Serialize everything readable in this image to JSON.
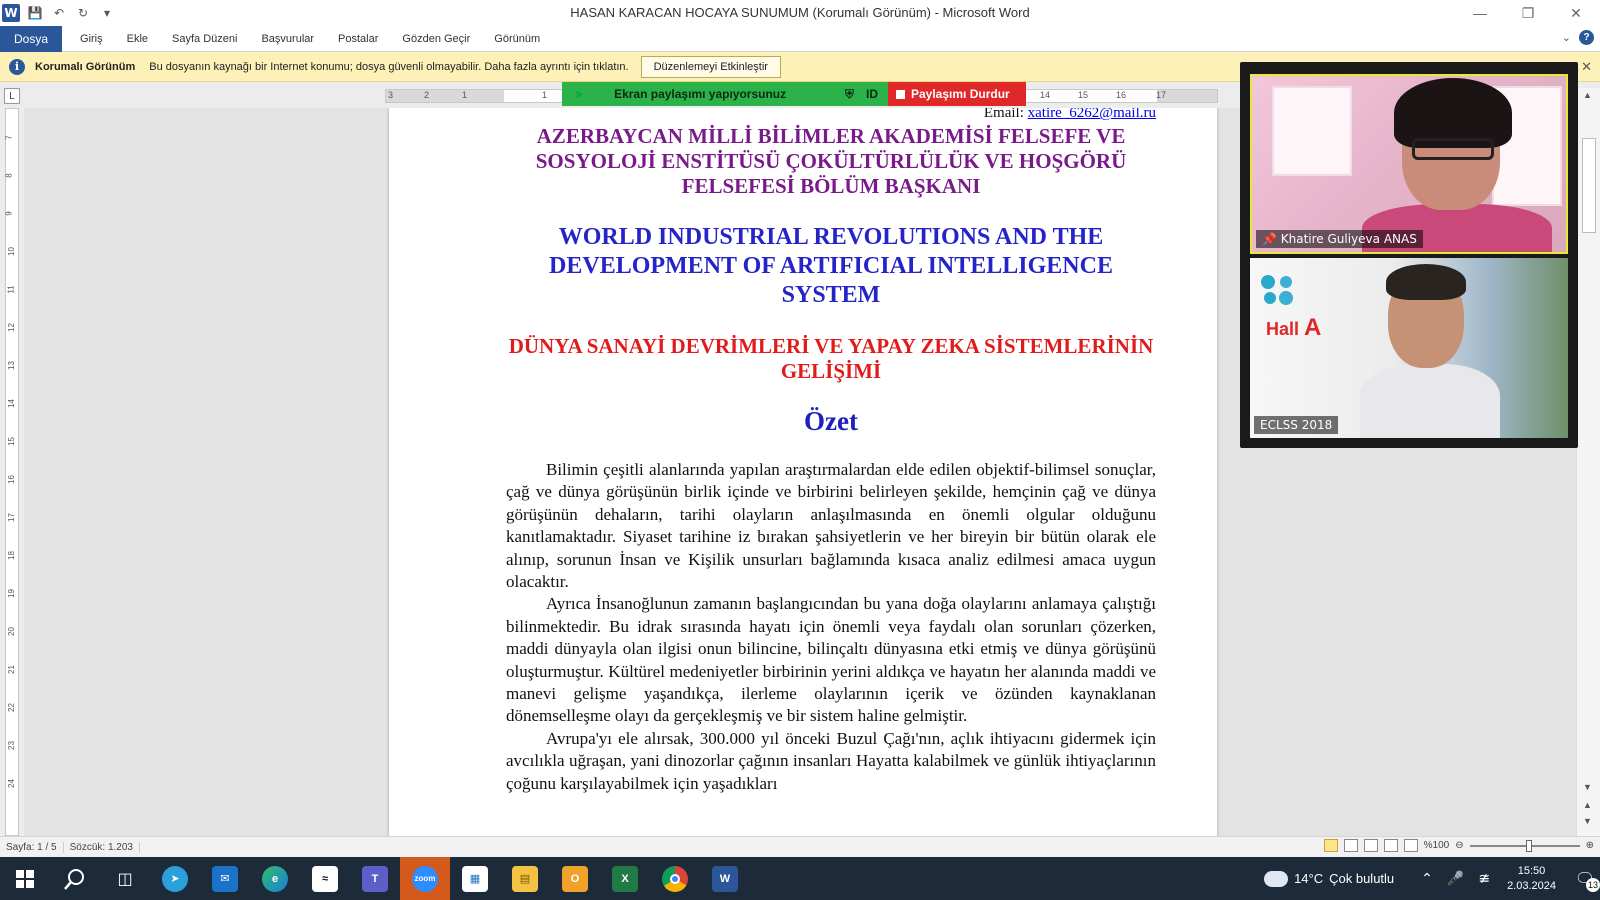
{
  "window": {
    "title": "HASAN  KARACAN HOCAYA SUNUMUM (Korumalı Görünüm) - Microsoft Word"
  },
  "ribbon": {
    "tabs": [
      "Dosya",
      "Giriş",
      "Ekle",
      "Sayfa Düzeni",
      "Başvurular",
      "Postalar",
      "Gözden Geçir",
      "Görünüm"
    ]
  },
  "protected_view": {
    "title": "Korumalı Görünüm",
    "message": "Bu dosyanın kaynağı bir Internet konumu; dosya güvenli olmayabilir. Daha fazla ayrıntı için tıklatın.",
    "button": "Düzenlemeyi Etkinleştir"
  },
  "share_banner": {
    "status": "Ekran paylaşımı yapıyorsunuz",
    "id_label": "ID",
    "stop_button": "Paylaşımı Durdur"
  },
  "ruler": {
    "h_ticks": [
      "3",
      "2",
      "1",
      "1",
      "14",
      "15",
      "16",
      "17"
    ],
    "v_ticks": [
      "7",
      "8",
      "9",
      "10",
      "11",
      "12",
      "13",
      "14",
      "15",
      "16",
      "17",
      "18",
      "19",
      "20",
      "21",
      "22",
      "23",
      "24"
    ]
  },
  "document": {
    "email_label": "Email: ",
    "email": "xatire_6262@mail.ru",
    "institution": "AZERBAYCAN MİLLİ  BİLİMLER AKADEMİSİ FELSEFE VE SOSYOLOJİ ENSTİTÜSÜ ÇOKÜLTÜRLÜLÜK VE HOŞGÖRÜ FELSEFESİ BÖLÜM BAŞKANI",
    "title_en": "WORLD INDUSTRIAL REVOLUTIONS AND THE DEVELOPMENT OF ARTIFICIAL INTELLIGENCE SYSTEM",
    "title_tr": "DÜNYA SANAYİ DEVRİMLERİ VE YAPAY  ZEKA SİSTEMLERİNİN  GELİŞİMİ",
    "abstract_heading": "Özet",
    "paragraphs": [
      "Bilimin çeşitli alanlarında yapılan araştırmalardan elde edilen objektif-bilimsel sonuçlar, çağ ve dünya görüşünün birlik içinde ve birbirini belirleyen şekilde, hemçinin çağ ve dünya görüşünün dehaların, tarihi olayların anlaşılmasında en önemli olgular olduğunu kanıtlamaktadır. Siyaset tarihine iz bırakan şahsiyetlerin ve her bireyin bir bütün olarak ele alınıp, sorunun İnsan ve Kişilik unsurları bağlamında kısaca  analiz edilmesi amaca uygun olacaktır.",
      "Ayrıca İnsanoğlunun zamanın başlangıcından bu yana doğa olaylarını anlamaya çalıştığı bilinmektedir. Bu idrak sırasında hayatı için önemli veya faydalı olan sorunları çözerken, maddi dünyayla olan  ilgisi onun bilincine, bilinçaltı dünyasına etki etmiş ve dünya görüşünü oluşturmuştur. Kültürel medeniyetler birbirinin yerini aldıkça ve hayatın her alanında maddi ve manevi gelişme yaşandıkça, ilerleme olaylarının içerik ve özünden kaynaklanan dönemselleşme olayı da gerçekleşmiş ve bir sistem haline gelmiştir.",
      "Avrupa'yı ele alırsak, 300.000 yıl önceki Buzul Çağı'nın, açlık ihtiyacını gidermek için avcılıkla uğraşan, yani dinozorlar çağının insanları Hayatta kalabilmek ve günlük ihtiyaçlarının çoğunu karşılayabilmek için yaşadıkları"
    ]
  },
  "participants": [
    {
      "name": "Khatire Guliyeva ANAS"
    },
    {
      "name": "ECLSS 2018",
      "hall_prefix": "Hall ",
      "hall_letter": "A"
    }
  ],
  "statusbar": {
    "page": "Sayfa: 1 / 5",
    "words": "Sözcük: 1.203",
    "zoom": "%100"
  },
  "taskbar": {
    "weather_temp": "14°C",
    "weather_desc": "Çok bulutlu",
    "time": "15:50",
    "date": "2.03.2024",
    "notifications": "13"
  },
  "colors": {
    "word_blue": "#2b579a",
    "share_green": "#2bb34a",
    "share_red": "#e02828",
    "institution_purple": "#7a1a8a",
    "title_blue": "#2424c8",
    "title_red": "#e11a1a"
  }
}
